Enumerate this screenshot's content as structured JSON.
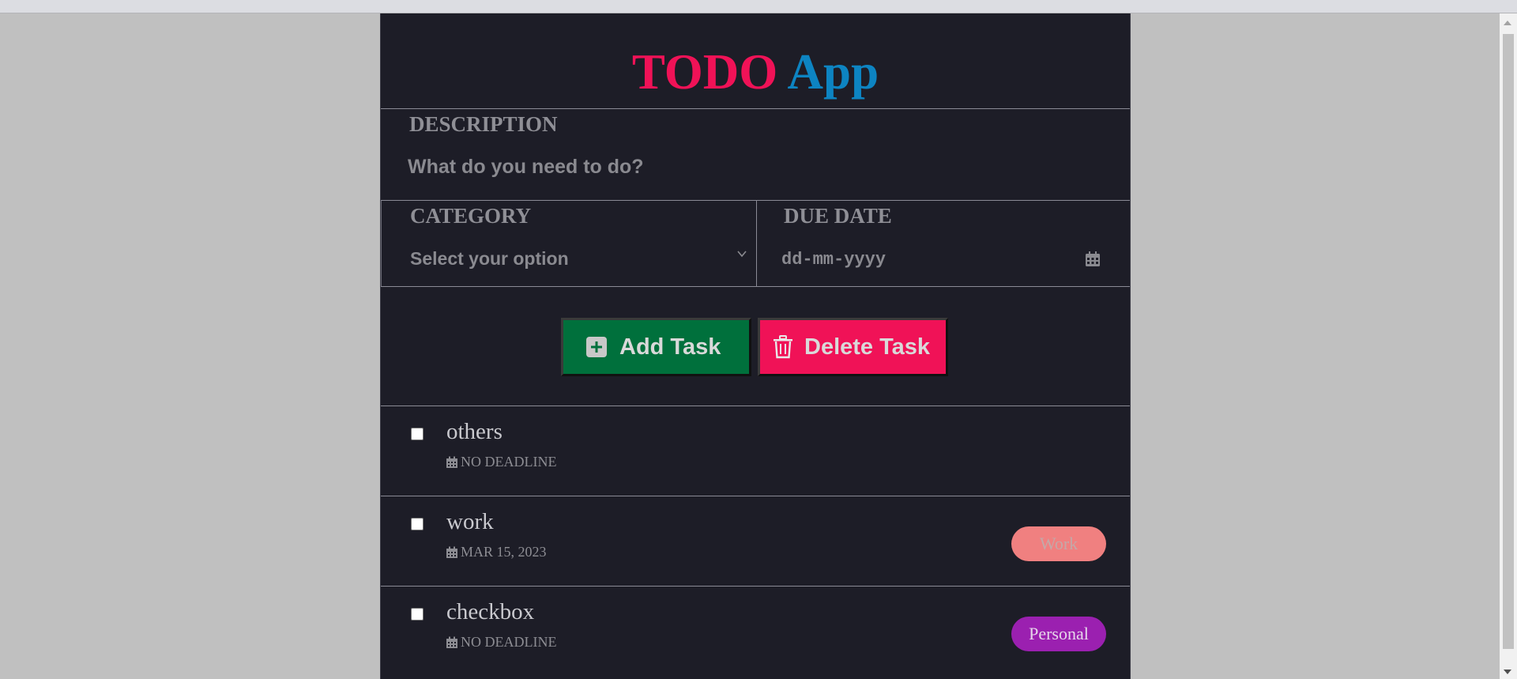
{
  "header": {
    "title_part1": "TODO",
    "title_part2": "App"
  },
  "form": {
    "description_label": "DESCRIPTION",
    "description_placeholder": "What do you need to do?",
    "category_label": "CATEGORY",
    "category_selected": "Select your option",
    "due_label": "DUE DATE",
    "due_placeholder": "dd-mm-yyyy"
  },
  "actions": {
    "add_label": "Add Task",
    "delete_label": "Delete Task"
  },
  "tasks": [
    {
      "title": "others",
      "deadline": "NO DEADLINE",
      "checked": false,
      "category": ""
    },
    {
      "title": "work",
      "deadline": "MAR 15, 2023",
      "checked": false,
      "category": "Work"
    },
    {
      "title": "checkbox",
      "deadline": "NO DEADLINE",
      "checked": false,
      "category": "Personal"
    }
  ],
  "colors": {
    "accent_red": "#f01257",
    "accent_blue": "#0d84c2",
    "add_green": "#00703c",
    "work_badge": "#f08080",
    "personal_badge": "#9b20b0",
    "background": "#1d1d27"
  }
}
